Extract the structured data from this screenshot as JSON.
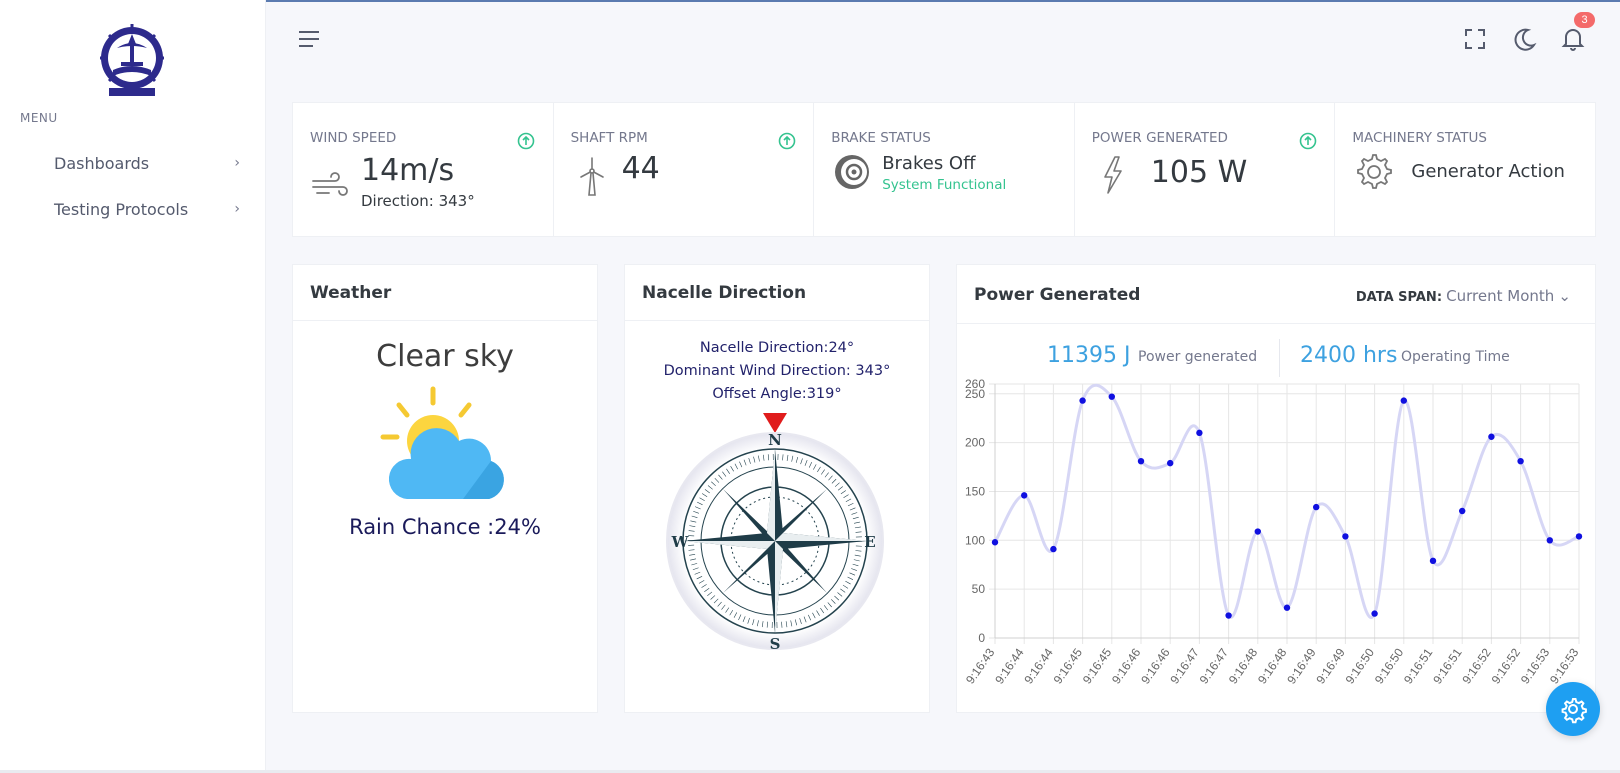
{
  "sidebar": {
    "menu_title": "MENU",
    "items": [
      {
        "label": "Dashboards",
        "icon": "chevron-right-icon"
      },
      {
        "label": "Testing Protocols",
        "icon": "chevron-right-icon"
      }
    ]
  },
  "header": {
    "notification_count": "3",
    "icons": [
      "menu-icon",
      "fullscreen-icon",
      "moon-icon",
      "bell-icon"
    ]
  },
  "stats": {
    "wind_speed": {
      "label": "WIND SPEED",
      "value": "14m/s",
      "sub": "Direction: 343°",
      "icon": "wind-icon",
      "trend_icon": "arrow-up-circle-icon"
    },
    "shaft_rpm": {
      "label": "SHAFT RPM",
      "value": "44",
      "icon": "turbine-icon",
      "trend_icon": "arrow-up-circle-icon"
    },
    "brake_status": {
      "label": "BRAKE STATUS",
      "value": "Brakes Off",
      "sub": "System Functional",
      "icon": "brake-disc-icon"
    },
    "power_generated": {
      "label": "POWER GENERATED",
      "value": "105 W",
      "icon": "lightning-icon",
      "trend_icon": "arrow-up-circle-icon"
    },
    "machinery_status": {
      "label": "MACHINERY STATUS",
      "value": "Generator Action",
      "icon": "gear-icon"
    }
  },
  "weather": {
    "title": "Weather",
    "condition": "Clear sky",
    "rain": "Rain Chance :24%",
    "icon": "partly-cloudy-icon"
  },
  "nacelle": {
    "title": "Nacelle Direction",
    "line1": "Nacelle Direction:24°",
    "line2": "Dominant Wind Direction: 343°",
    "line3": "Offset Angle:319°",
    "compass_letters": [
      "N",
      "E",
      "S",
      "W"
    ]
  },
  "power": {
    "title": "Power Generated",
    "span_label": "DATA SPAN:",
    "span_value": "Current Month",
    "energy_value": "11395 J",
    "energy_label": "Power generated",
    "time_value": "2400 hrs",
    "time_label": "Operating Time"
  },
  "colors": {
    "accent": "#3da1e0",
    "green": "#34c38f",
    "point": "#1010e0",
    "line": "#d6d6f5",
    "badge": "#f46a6a",
    "fab": "#1e9ff2"
  },
  "chart_data": {
    "type": "line",
    "x": [
      "9:16:43",
      "9:16:44",
      "9:16:44",
      "9:16:45",
      "9:16:45",
      "9:16:46",
      "9:16:46",
      "9:16:47",
      "9:16:47",
      "9:16:48",
      "9:16:48",
      "9:16:49",
      "9:16:49",
      "9:16:50",
      "9:16:50",
      "9:16:51",
      "9:16:51",
      "9:16:52",
      "9:16:52",
      "9:16:53",
      "9:16:53"
    ],
    "values": [
      98,
      146,
      91,
      243,
      247,
      181,
      179,
      210,
      23,
      109,
      31,
      134,
      104,
      25,
      243,
      79,
      130,
      206,
      181,
      100,
      104
    ],
    "ylim": [
      0,
      260
    ],
    "yticks": [
      0,
      50,
      100,
      150,
      200,
      250,
      260
    ],
    "grid": true
  }
}
